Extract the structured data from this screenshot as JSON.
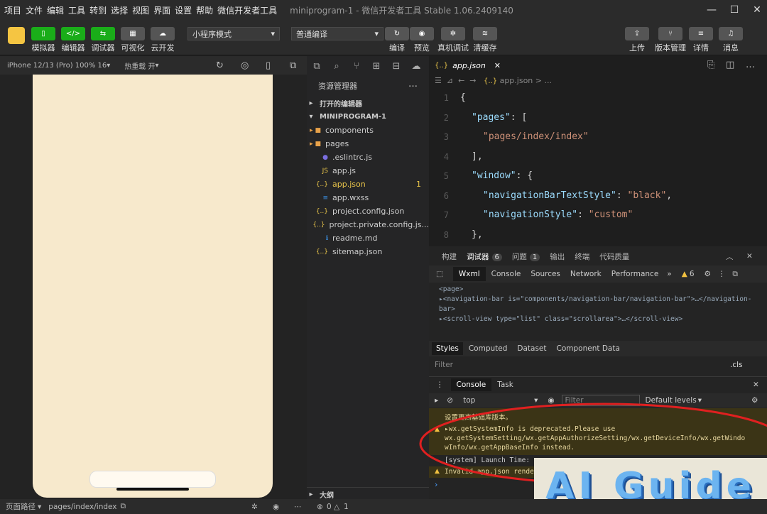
{
  "menu": [
    "项目",
    "文件",
    "编辑",
    "工具",
    "转到",
    "选择",
    "视图",
    "界面",
    "设置",
    "帮助",
    "微信开发者工具"
  ],
  "window_title": "miniprogram-1 - 微信开发者工具 Stable 1.06.2409140",
  "toolbar": {
    "left_buttons": [
      "模拟器",
      "编辑器",
      "调试器",
      "可视化",
      "云开发"
    ],
    "mode_select": "小程序模式",
    "compile_select": "普通编译",
    "mid_buttons": [
      "编译",
      "预览",
      "真机调试",
      "清缓存"
    ],
    "right_buttons": [
      "上传",
      "版本管理",
      "详情",
      "消息"
    ]
  },
  "simulator": {
    "device": "iPhone 12/13 (Pro) 100% 16",
    "hot_reload": "热重载 开"
  },
  "explorer": {
    "title": "资源管理器",
    "open_editors": "打开的编辑器",
    "project": "MINIPROGRAM-1",
    "items": [
      {
        "name": "components",
        "type": "folder"
      },
      {
        "name": "pages",
        "type": "folder"
      },
      {
        "name": ".eslintrc.js",
        "type": "eslint"
      },
      {
        "name": "app.js",
        "type": "js"
      },
      {
        "name": "app.json",
        "type": "json",
        "badge": "1"
      },
      {
        "name": "app.wxss",
        "type": "wxss"
      },
      {
        "name": "project.config.json",
        "type": "json"
      },
      {
        "name": "project.private.config.js...",
        "type": "json"
      },
      {
        "name": "readme.md",
        "type": "info"
      },
      {
        "name": "sitemap.json",
        "type": "json"
      }
    ],
    "outline": "大纲"
  },
  "editor": {
    "tab": "app.json",
    "breadcrumb": "app.json > ...",
    "line_numbers": [
      "1",
      "2",
      "3",
      "4",
      "5",
      "6",
      "7",
      "8"
    ]
  },
  "devtools": {
    "panel_tabs": {
      "build": "构建",
      "debugger": "调试器",
      "debugger_count": "6",
      "issues": "问题",
      "issues_count": "1",
      "output": "输出",
      "terminal": "终端",
      "code_quality": "代码质量"
    },
    "tabs": [
      "Wxml",
      "Console",
      "Sources",
      "Network",
      "Performance"
    ],
    "warn_count": "6",
    "wxml_lines": [
      "<page>",
      "▸<navigation-bar is=\"components/navigation-bar/navigation-bar\">…</navigation-",
      "bar>",
      "▸<scroll-view type=\"list\" class=\"scrollarea\">…</scroll-view>"
    ],
    "style_tabs": [
      "Styles",
      "Computed",
      "Dataset",
      "Component Data"
    ],
    "filter_placeholder": "Filter",
    "cls": ".cls",
    "console_tabs": [
      "Console",
      "Task"
    ],
    "context": "top",
    "console_filter": "Filter",
    "levels": "Default levels",
    "messages": [
      "设置更高基础库版本。",
      "▸wx.getSystemInfo is deprecated.Please use",
      "wx.getSystemSetting/wx.getAppAuthorizeSetting/wx.getDeviceInfo/wx.getWindo",
      "wInfo/wx.getAppBaseInfo instead.",
      "[system] Launch Time: ",
      "Invalid app.json rende"
    ]
  },
  "status": {
    "path_label": "页面路径",
    "path": "pages/index/index",
    "errors": "0",
    "warnings": "1"
  },
  "watermark": "AI Guide"
}
